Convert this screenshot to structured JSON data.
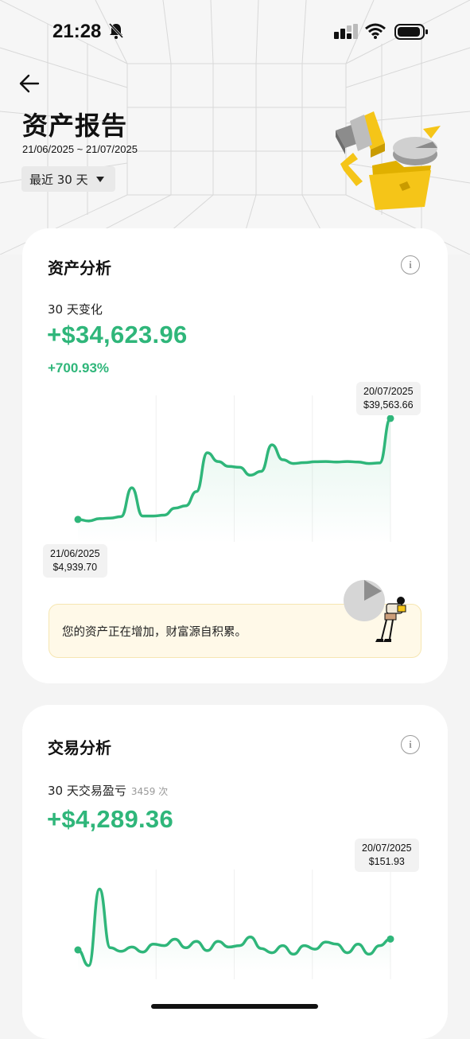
{
  "status_bar": {
    "time": "21:28",
    "icons": [
      "bell-off-icon",
      "signal-icon",
      "wifi-icon",
      "battery-icon"
    ]
  },
  "header": {
    "title": "资产报告",
    "date_range": "21/06/2025 ~ 21/07/2025",
    "range_selector": "最近 30 天"
  },
  "asset_card": {
    "title": "资产分析",
    "subtitle": "30 天变化",
    "change_amount": "+$34,623.96",
    "change_percent": "+700.93%",
    "end_tip": {
      "date": "20/07/2025",
      "value": "$39,563.66"
    },
    "start_tip": {
      "date": "21/06/2025",
      "value": "$4,939.70"
    },
    "notice": "您的资产正在增加，财富源自积累。"
  },
  "trade_card": {
    "title": "交易分析",
    "subtitle": "30 天交易盈亏",
    "trade_count": "3459 次",
    "pnl": "+$4,289.36",
    "end_tip": {
      "date": "20/07/2025",
      "value": "$151.93"
    }
  },
  "colors": {
    "accent_green": "#2fb67a",
    "illustration_yellow": "#f5c518"
  },
  "chart_data": [
    {
      "type": "area",
      "name": "asset",
      "x": [
        "21/06/2025",
        "",
        "",
        "",
        "",
        "",
        "",
        "",
        "",
        "",
        "",
        "",
        "",
        "",
        "",
        "",
        "",
        "",
        "",
        "",
        "",
        "",
        "",
        "",
        "",
        "",
        "",
        "",
        "",
        "20/07/2025"
      ],
      "values": [
        4939.7,
        4400,
        5200,
        5400,
        5900,
        15800,
        6100,
        6100,
        6400,
        8800,
        9600,
        14500,
        27800,
        24800,
        23100,
        22800,
        20100,
        21400,
        30500,
        25400,
        24100,
        24400,
        24700,
        24800,
        24600,
        24800,
        24600,
        24100,
        24300,
        39563.66
      ],
      "ylim": [
        0,
        42000
      ]
    },
    {
      "type": "area",
      "name": "trade_pnl",
      "x": [
        "21/06/2025",
        "",
        "",
        "",
        "",
        "",
        "",
        "",
        "",
        "",
        "",
        "",
        "",
        "",
        "",
        "",
        "",
        "",
        "",
        "",
        "",
        "",
        "",
        "",
        "",
        "",
        "",
        "",
        "",
        "20/07/2025"
      ],
      "values": [
        0,
        -220,
        850,
        30,
        -20,
        40,
        -30,
        80,
        60,
        150,
        30,
        120,
        -10,
        120,
        40,
        60,
        180,
        20,
        -40,
        60,
        -60,
        60,
        10,
        110,
        80,
        -40,
        80,
        -60,
        60,
        151.93
      ],
      "ylim": [
        -300,
        900
      ]
    }
  ]
}
